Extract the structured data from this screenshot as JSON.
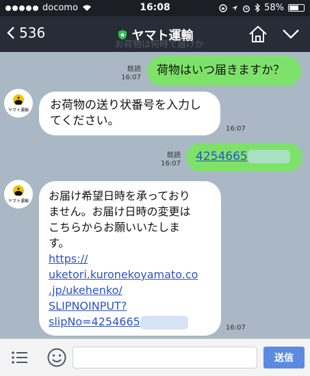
{
  "status": {
    "carrier": "docomo",
    "time": "16:08",
    "battery": "58%",
    "battery_level": 0.58
  },
  "header": {
    "back_count": "536",
    "title": "ヤマト運輸",
    "ghost_text": "お荷物は何時で届けか"
  },
  "messages": [
    {
      "id": "m1",
      "side": "out",
      "read": "既読",
      "time": "16:07",
      "text": "荷物はいつ届きますか？"
    },
    {
      "id": "m2",
      "side": "in",
      "time": "16:07",
      "lines": [
        "お荷物の送り状番号を入力し",
        "てください。"
      ]
    },
    {
      "id": "m3",
      "side": "out",
      "read": "既読",
      "time": "16:07",
      "link": "4254665"
    },
    {
      "id": "m4",
      "side": "in",
      "time": "16:07",
      "lines": [
        "お届け希望日時を承っており",
        "ません。お届け日時の変更は",
        "こちらからお願いいたしま",
        "す。"
      ],
      "link_lines": [
        "https://",
        "uketori.kuronekoyamato.co",
        ".jp/ukehenko/",
        "SLIPNOINPUT?",
        "slipNo=4254665"
      ]
    }
  ],
  "input": {
    "placeholder": "",
    "send_label": "送信"
  },
  "colors": {
    "outgoing": "#7ee26a",
    "incoming": "#ffffff",
    "background": "#a9b8c4",
    "link": "#2b52c8",
    "send": "#5b8be0"
  }
}
